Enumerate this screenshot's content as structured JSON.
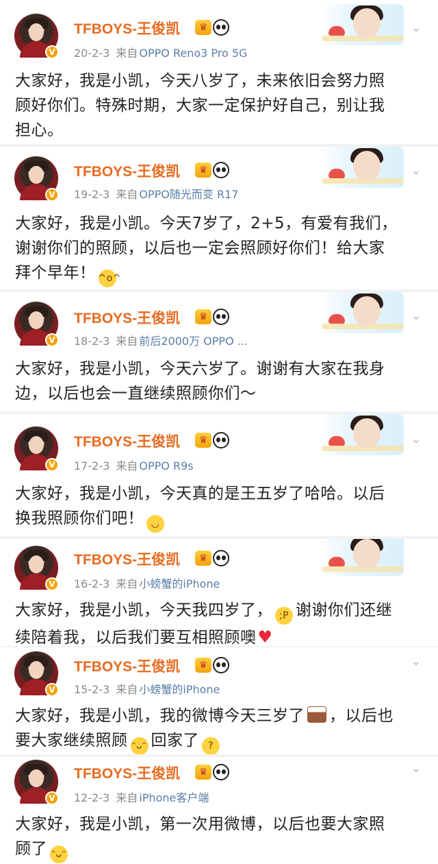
{
  "posts": [
    {
      "user": "TFBOYS-王俊凯",
      "date": "20-2-3",
      "from": "来自",
      "source": "OPPO Reno3 Pro 5G",
      "lines": [
        "大家好，我是小凯，今天八岁了，未来依旧会努力照",
        "顾好你们。特殊时期，大家一定保护好自己，别让我",
        "担心。"
      ]
    },
    {
      "user": "TFBOYS-王俊凯",
      "date": "19-2-3",
      "from": "来自",
      "source": "OPPO随光而变 R17",
      "lines": [
        "大家好，我是小凯。今天7岁了，2+5，有爱有我们，",
        "谢谢你们的照顾，以后也一定会照顾好你们！给大家",
        "拜个早年！"
      ]
    },
    {
      "user": "TFBOYS-王俊凯",
      "date": "18-2-3",
      "from": "来自",
      "source": "前后2000万 OPPO ...",
      "lines": [
        "大家好，我是小凯，今天六岁了。谢谢有大家在我身",
        "边，以后也会一直继续照顾你们～"
      ]
    },
    {
      "user": "TFBOYS-王俊凯",
      "date": "17-2-3",
      "from": "来自",
      "source": "OPPO R9s",
      "lines": [
        "大家好，我是小凯，今天真的是王五岁了哈哈。以后",
        "换我照顾你们吧！"
      ]
    },
    {
      "user": "TFBOYS-王俊凯",
      "date": "16-2-3",
      "from": "来自",
      "source": "小螃蟹的iPhone",
      "lines": [
        "大家好，我是小凯，今天我四岁了，",
        "谢谢你们还继",
        "续陪着我，以后我们要互相照顾噢"
      ]
    },
    {
      "user": "TFBOYS-王俊凯",
      "date": "15-2-3",
      "from": "来自",
      "source": "小螃蟹的iPhone",
      "lines": [
        "大家好，我是小凯，我的微博今天三岁了",
        "，以后也",
        "要大家继续照顾",
        "回家了"
      ]
    },
    {
      "user": "TFBOYS-王俊凯",
      "date": "12-2-3",
      "from": "来自",
      "source": "iPhone客户端",
      "lines": [
        "大家好，我是小凯，第一次用微博，以后也要大家照",
        "顾了"
      ]
    }
  ],
  "icons": {
    "vip": "vip-badge-icon",
    "crown": "crown-icon",
    "panda": "panda-icon",
    "chevron": "chevron-down-icon"
  },
  "colors": {
    "name": "#e86b1f",
    "source": "#5a7ea8",
    "meta": "#8a8a8a",
    "badge": "#f5a200"
  }
}
